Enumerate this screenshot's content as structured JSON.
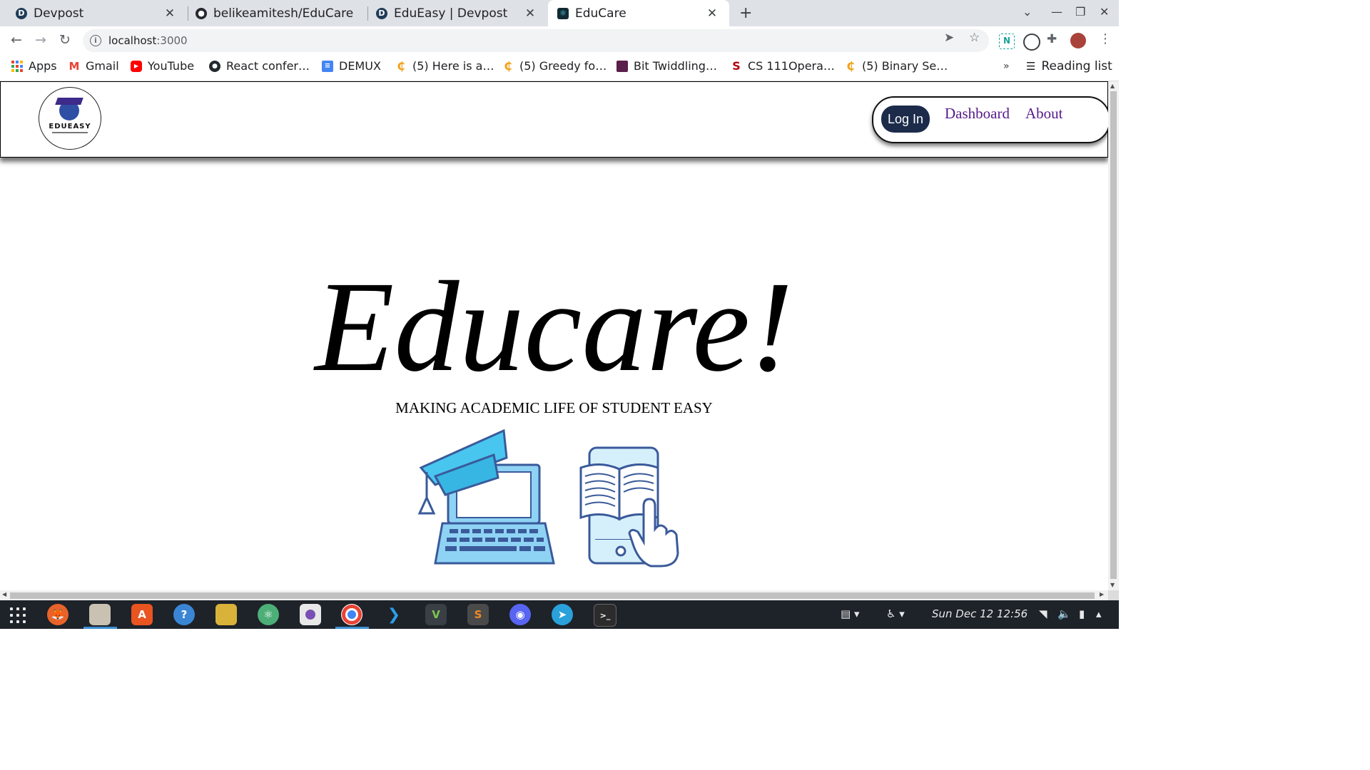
{
  "browser": {
    "tabs": [
      {
        "title": "Devpost",
        "icon": "devpost-icon"
      },
      {
        "title": "belikeamitesh/EduCare",
        "icon": "github-icon"
      },
      {
        "title": "EduEasy | Devpost",
        "icon": "devpost-icon"
      },
      {
        "title": "EduCare",
        "icon": "react-icon",
        "active": true
      }
    ],
    "address": {
      "host": "localhost",
      "port": ":3000"
    },
    "bookmarks": [
      {
        "label": "Apps",
        "icon": "apps-grid-icon"
      },
      {
        "label": "Gmail",
        "icon": "gmail-icon"
      },
      {
        "label": "YouTube",
        "icon": "youtube-icon"
      },
      {
        "label": "React confer…",
        "icon": "github-icon"
      },
      {
        "label": "DEMUX",
        "icon": "docs-icon"
      },
      {
        "label": "(5) Here is a…",
        "icon": "leetcode-icon"
      },
      {
        "label": "(5) Greedy fo…",
        "icon": "leetcode-icon"
      },
      {
        "label": "Bit Twiddling…",
        "icon": "bookmark-icon"
      },
      {
        "label": "CS 111Opera…",
        "icon": "stanford-icon"
      },
      {
        "label": "(5) Binary Se…",
        "icon": "leetcode-icon"
      }
    ],
    "overflow_label": "»",
    "reading_list": "Reading list"
  },
  "site": {
    "logo_text": "EDUEASY",
    "nav": {
      "login": "Log In",
      "dashboard": "Dashboard",
      "about": "About"
    },
    "hero_title": "Educare!",
    "hero_subtitle": "MAKING ACADEMIC LIFE OF STUDENT EASY"
  },
  "taskbar": {
    "apps": [
      "app-grid",
      "firefox",
      "files",
      "software-center",
      "help",
      "gnome-tweaks",
      "atom",
      "screenshot",
      "chrome",
      "vscode",
      "vim",
      "sublime-text",
      "discord",
      "telegram",
      "terminal"
    ],
    "clock": "Sun Dec 12  12:56"
  },
  "colors": {
    "login_bg": "#1c2b4a",
    "link": "#551a8b",
    "illustration": "#8fd3f4",
    "outline": "#3a5a9a"
  }
}
